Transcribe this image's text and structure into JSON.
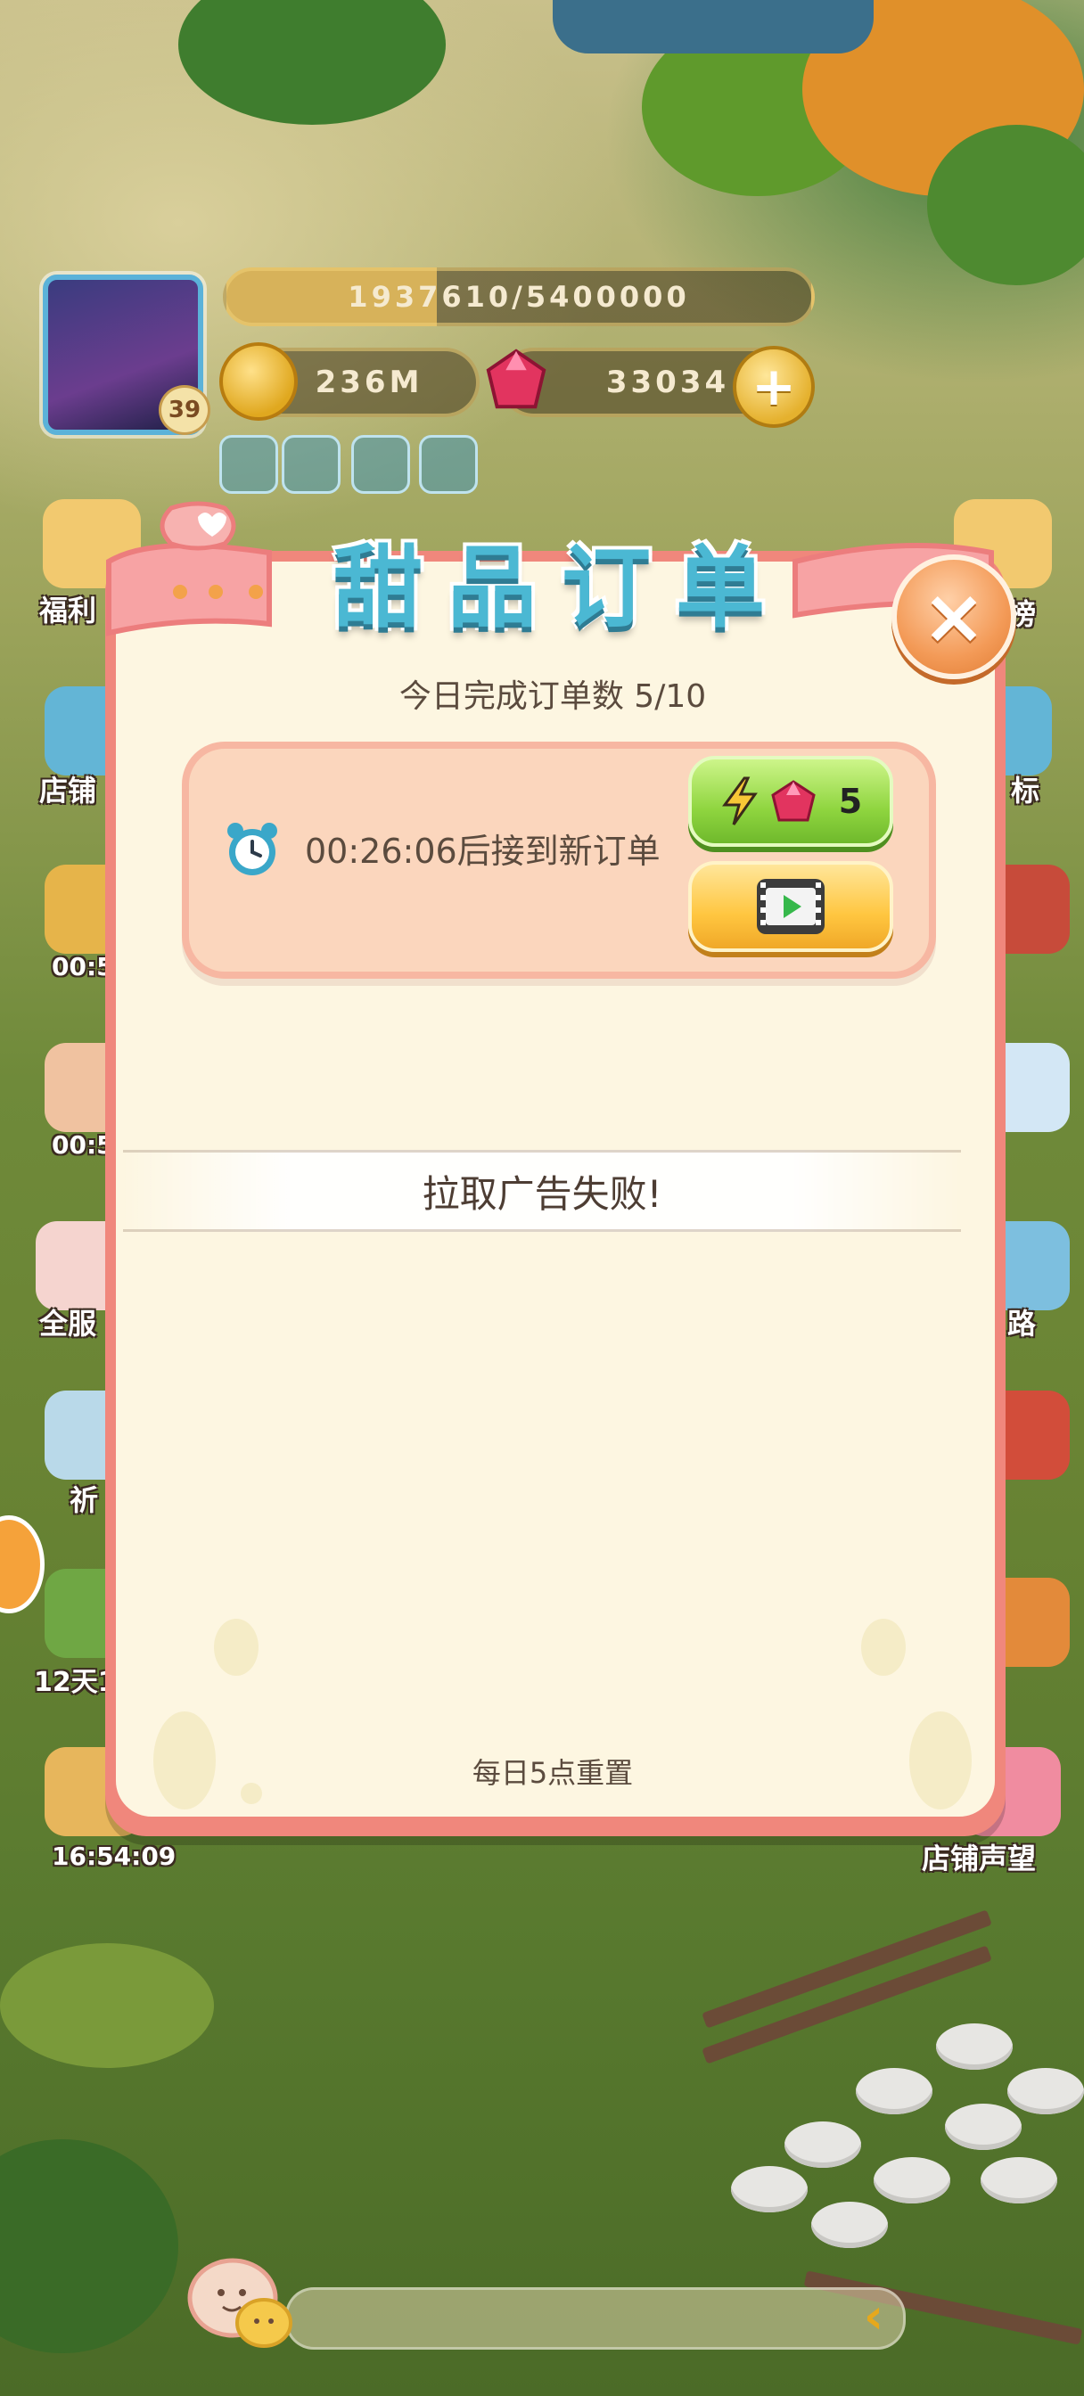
{
  "hud": {
    "level": "39",
    "xp": "1937610/5400000",
    "xp_progress": 0.359,
    "coins": "236M",
    "gems": "33034",
    "plus_label": "+"
  },
  "side_left": {
    "welfare": "福利",
    "shop": "店铺",
    "timer1": "00:5",
    "timer2": "00:5",
    "all_server": "全服",
    "pray": "祈",
    "days": "12天1",
    "timer3": "16:54:09"
  },
  "side_right": {
    "list": "榜",
    "target": "标",
    "road": "路",
    "reputation": "店铺声望"
  },
  "modal": {
    "title": "甜品订单",
    "close_label": "×",
    "daily_count": "今日完成订单数 5/10",
    "timer_text": "00:26:06后接到新订单",
    "speed_cost": "5",
    "toast": "拉取广告失败!",
    "reset_text": "每日5点重置"
  },
  "colors": {
    "modal_border": "#f0877c",
    "modal_bg": "#fdf6e1",
    "title": "#4bb8d3",
    "speed_btn": "#8fd53f",
    "video_btn": "#ffc640"
  },
  "icons": {
    "clock": "alarm-clock-icon",
    "lightning": "lightning-icon",
    "gem": "gem-icon",
    "video": "video-play-icon"
  }
}
